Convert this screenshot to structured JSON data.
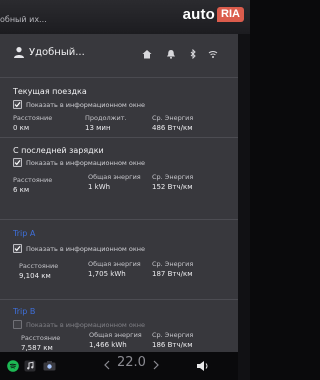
{
  "top": {
    "label": "обный их..."
  },
  "watermark": {
    "auto": "auto",
    "ria": "RIA"
  },
  "profile": {
    "name": "Удобный..."
  },
  "sections": [
    {
      "title": "Текущая поездка",
      "checkbox": {
        "label": "Показать в информационном окне",
        "checked": true
      },
      "stats": [
        {
          "label": "Расстояние",
          "value": "0 км"
        },
        {
          "label": "Продолжит.",
          "value": "13 мин"
        },
        {
          "label": "Ср. Энергия",
          "value": "486 Втч/км"
        }
      ]
    },
    {
      "title": "С последней зарядки",
      "checkbox": {
        "label": "Показать в информационном окне",
        "checked": true
      },
      "stats": [
        {
          "label": "Расстояние",
          "value": "6 км"
        },
        {
          "label": "Общая энергия",
          "value": "1 kWh"
        },
        {
          "label": "Ср. Энергия",
          "value": "152 Втч/км"
        }
      ]
    },
    {
      "title": "Trip A",
      "checkbox": {
        "label": "Показать в информационном окне",
        "checked": true
      },
      "stats": [
        {
          "label": "Расстояние",
          "value": "9,104 км"
        },
        {
          "label": "Общая энергия",
          "value": "1,705 kWh"
        },
        {
          "label": "Ср. Энергия",
          "value": "187 Втч/км"
        }
      ]
    },
    {
      "title": "Trip B",
      "checkbox": {
        "label": "Показать в информационном окне",
        "checked": false
      },
      "stats": [
        {
          "label": "Расстояние",
          "value": "7,587 км"
        },
        {
          "label": "Общая энергия",
          "value": "1,466 kWh"
        },
        {
          "label": "Ср. Энергия",
          "value": "186 Втч/км"
        }
      ]
    }
  ],
  "taskbar": {
    "temperature": "22.0"
  },
  "colors": {
    "accent": "#3e6fd9",
    "screen": "#38383d",
    "watermark": "#db5c4c"
  },
  "icons": [
    "user-icon",
    "home-icon",
    "bell-icon",
    "bluetooth-icon",
    "wifi-icon",
    "spotify-icon",
    "music-icon",
    "camera-icon",
    "volume-icon",
    "chevron-left-icon",
    "chevron-right-icon"
  ]
}
